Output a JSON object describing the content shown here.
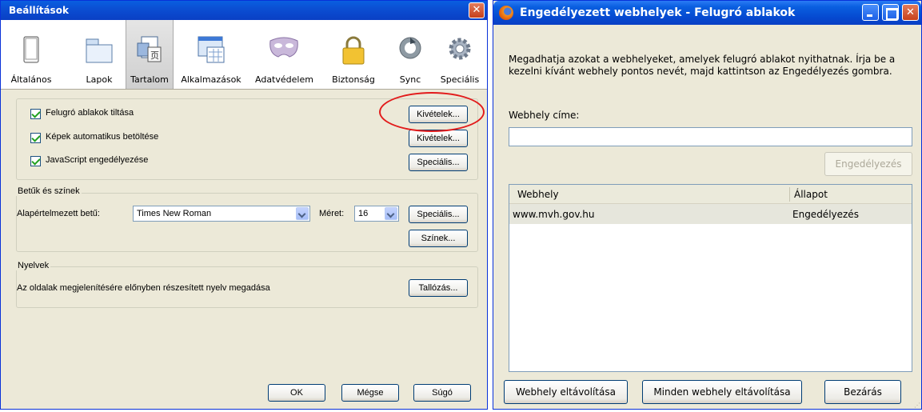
{
  "left_window": {
    "title": "Beállítások",
    "close_glyph": "✕",
    "toolbar": [
      {
        "label": "Általános",
        "icon": "general-icon"
      },
      {
        "label": "Lapok",
        "icon": "tabs-icon"
      },
      {
        "label": "Tartalom",
        "icon": "content-icon"
      },
      {
        "label": "Alkalmazások",
        "icon": "applications-icon"
      },
      {
        "label": "Adatvédelem",
        "icon": "privacy-mask-icon"
      },
      {
        "label": "Biztonság",
        "icon": "security-lock-icon"
      },
      {
        "label": "Sync",
        "icon": "sync-icon"
      },
      {
        "label": "Speciális",
        "icon": "advanced-gear-icon"
      }
    ],
    "content": {
      "popup_block": {
        "label": "Felugró ablakok tiltása",
        "checked": true,
        "button": "Kivételek..."
      },
      "load_images": {
        "label": "Képek automatikus betöltése",
        "checked": true,
        "button": "Kivételek..."
      },
      "javascript": {
        "label": "JavaScript engedélyezése",
        "checked": true,
        "button": "Speciális..."
      }
    },
    "fonts": {
      "group_label": "Betűk és színek",
      "default_font_label": "Alapértelmezett betű:",
      "default_font_value": "Times New Roman",
      "size_label": "Méret:",
      "size_value": "16",
      "advanced_button": "Speciális...",
      "colors_button": "Színek..."
    },
    "languages": {
      "group_label": "Nyelvek",
      "description": "Az oldalak megjelenítésére előnyben részesített nyelv megadása",
      "button": "Tallózás..."
    },
    "footer": {
      "ok": "OK",
      "cancel": "Mégse",
      "help": "Súgó"
    }
  },
  "right_window": {
    "title": "Engedélyezett webhelyek - Felugró ablakok",
    "close_glyph": "✕",
    "description": "Megadhatja azokat a webhelyeket, amelyek felugró ablakot nyithatnak. Írja be a kezelni kívánt webhely pontos nevét, majd kattintson az Engedélyezés gombra.",
    "address_label": "Webhely címe:",
    "address_value": "",
    "allow_button": "Engedélyezés",
    "list": {
      "columns": [
        "Webhely",
        "Állapot"
      ],
      "rows": [
        {
          "site": "www.mvh.gov.hu",
          "status": "Engedélyezés"
        }
      ]
    },
    "footer": {
      "remove": "Webhely eltávolítása",
      "remove_all": "Minden webhely eltávolítása",
      "close": "Bezárás"
    }
  },
  "colors": {
    "annotation_ellipse": "#e21b1b",
    "titlebar": "#0a5fe0"
  }
}
